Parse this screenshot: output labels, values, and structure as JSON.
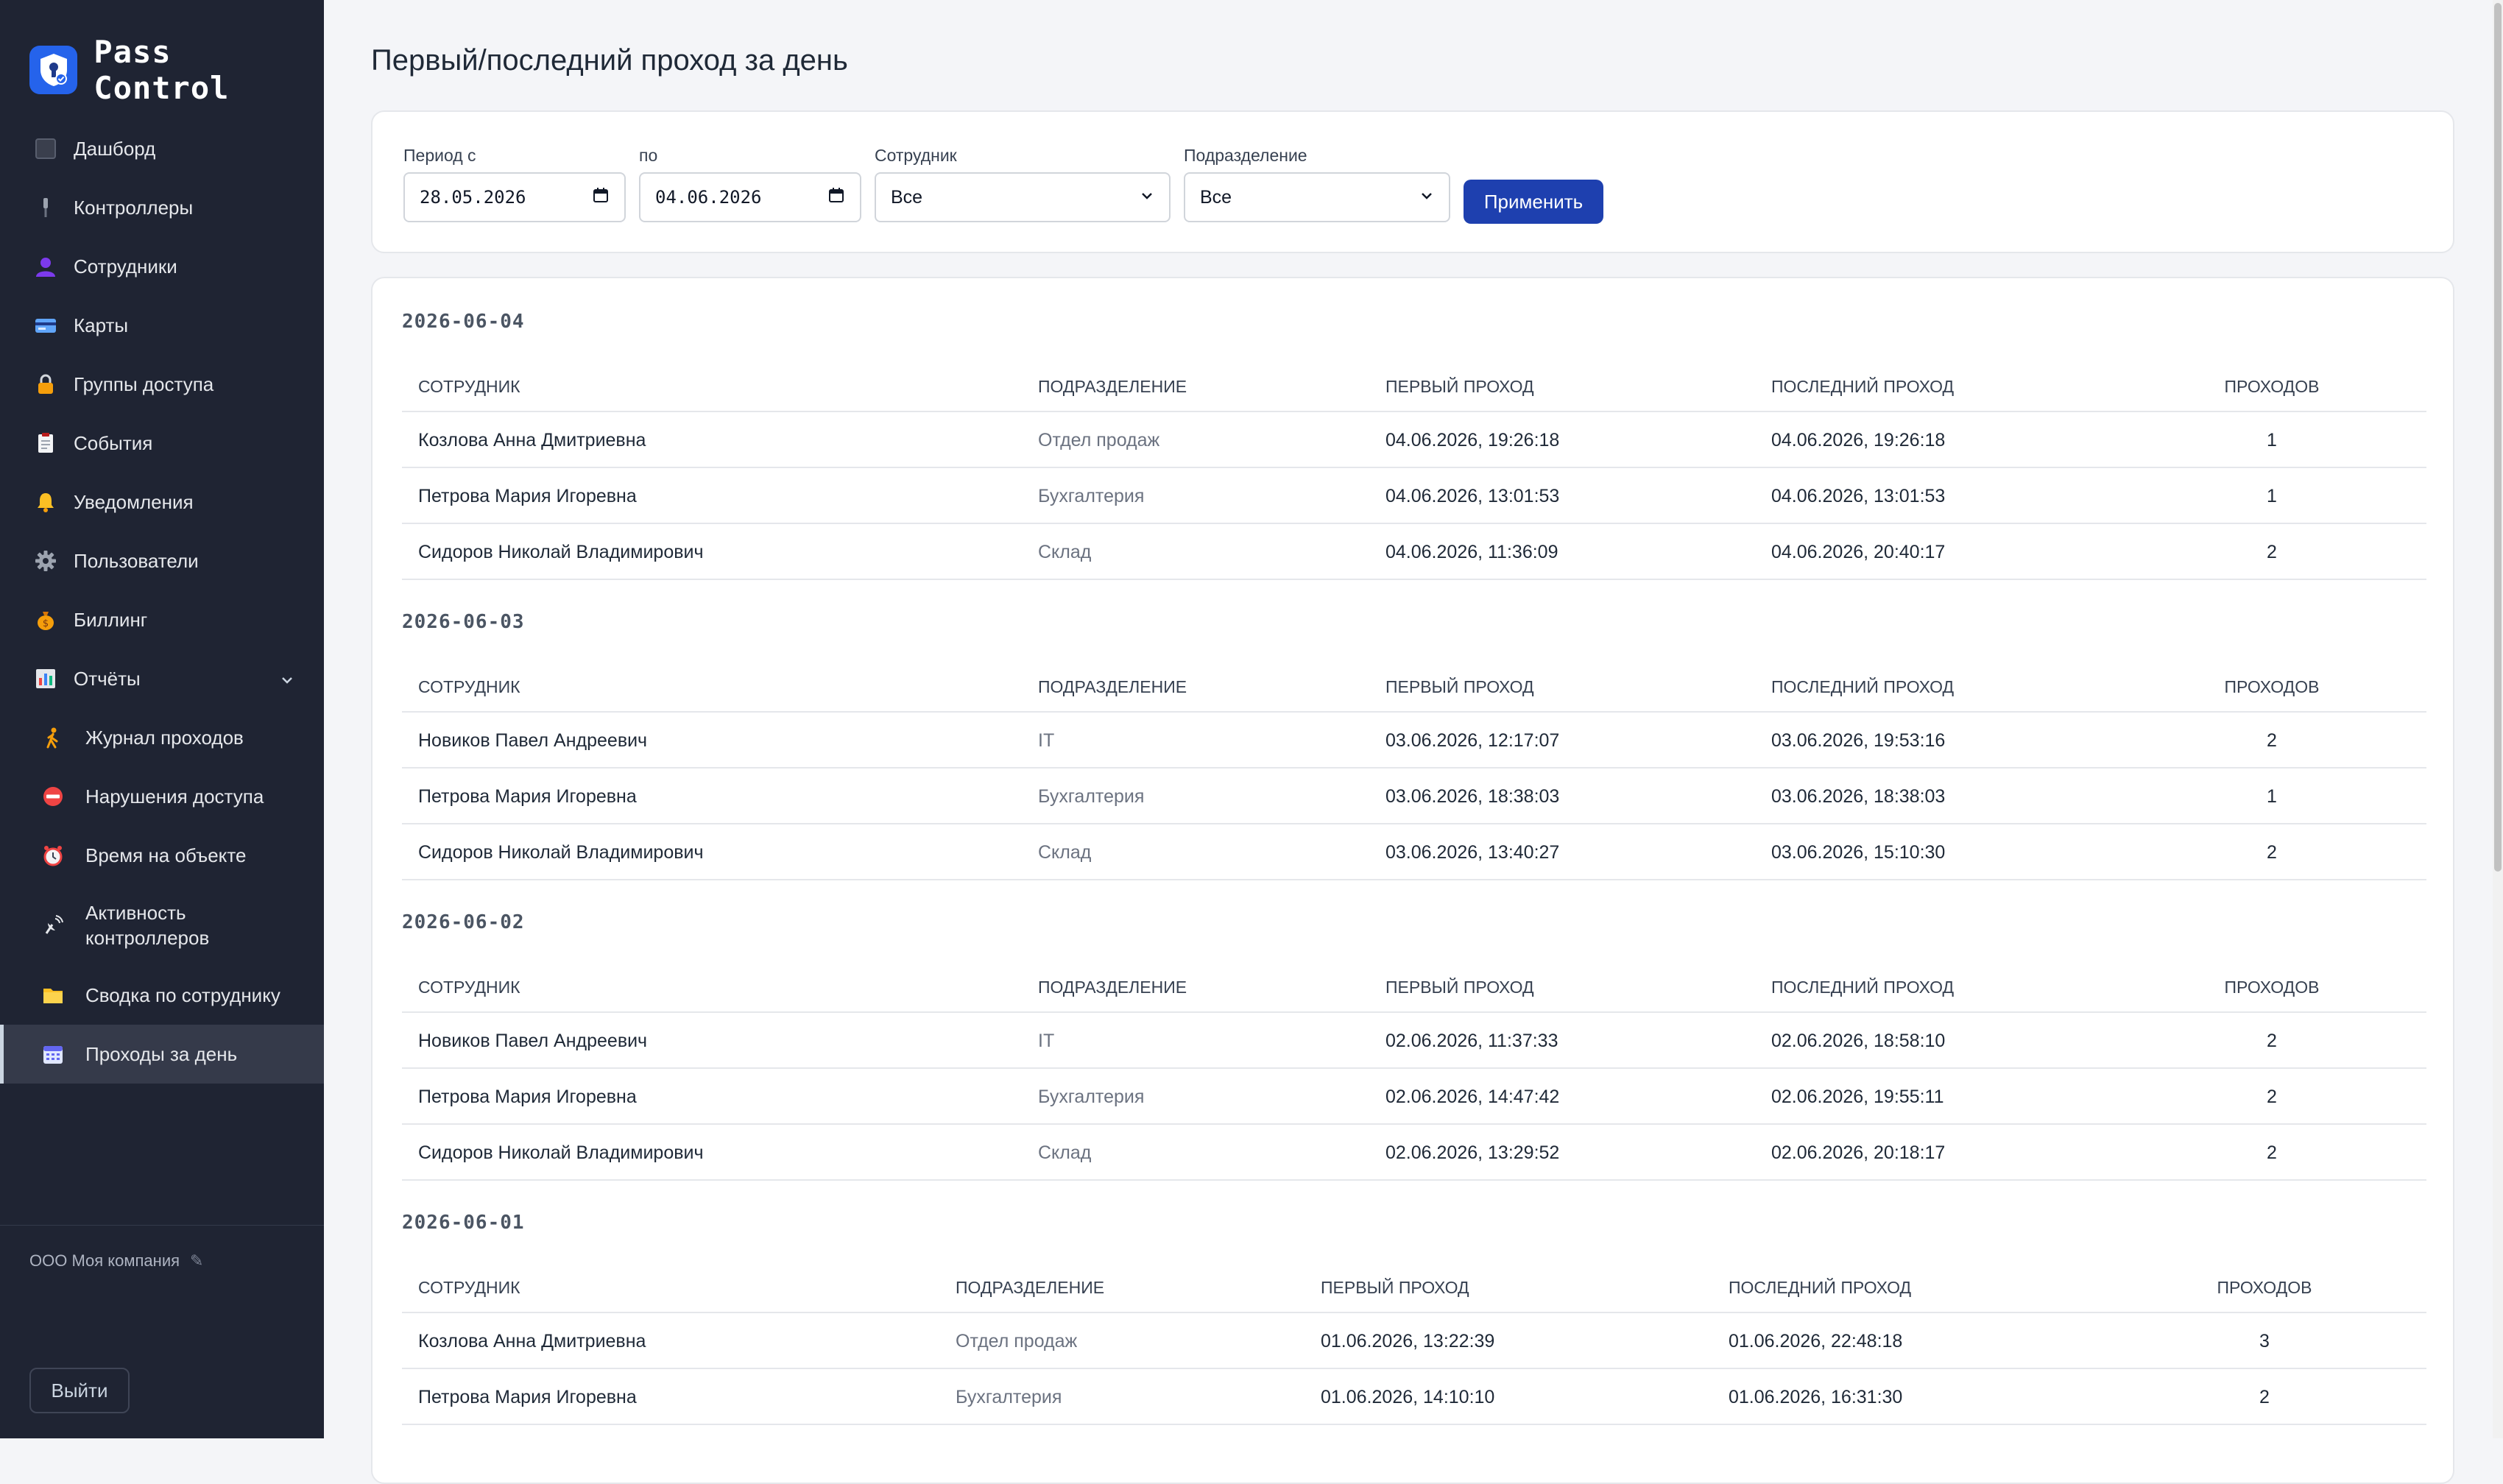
{
  "brand": {
    "name": "Pass Control"
  },
  "sidebar": {
    "items": [
      {
        "label": "Дашборд",
        "icon": "dashboard-icon"
      },
      {
        "label": "Контроллеры",
        "icon": "controller-icon"
      },
      {
        "label": "Сотрудники",
        "icon": "user-icon"
      },
      {
        "label": "Карты",
        "icon": "card-icon"
      },
      {
        "label": "Группы доступа",
        "icon": "lock-icon"
      },
      {
        "label": "События",
        "icon": "clipboard-icon"
      },
      {
        "label": "Уведомления",
        "icon": "bell-icon"
      },
      {
        "label": "Пользователи",
        "icon": "gear-icon"
      },
      {
        "label": "Биллинг",
        "icon": "money-bag-icon"
      },
      {
        "label": "Отчёты",
        "icon": "chart-icon"
      }
    ],
    "report_items": [
      {
        "label": "Журнал проходов",
        "icon": "walking-person-icon"
      },
      {
        "label": "Нарушения доступа",
        "icon": "no-entry-icon"
      },
      {
        "label": "Время на объекте",
        "icon": "alarm-clock-icon"
      },
      {
        "label": "Активность контроллеров",
        "icon": "satellite-icon"
      },
      {
        "label": "Сводка по сотруднику",
        "icon": "folder-icon"
      },
      {
        "label": "Проходы за день",
        "icon": "calendar-icon"
      }
    ],
    "company": "ООО Моя компания",
    "logout_label": "Выйти"
  },
  "page": {
    "title": "Первый/последний проход за день"
  },
  "filters": {
    "period_from_label": "Период с",
    "period_from_value": "28.05.2026",
    "period_to_label": "по",
    "period_to_value": "04.06.2026",
    "employee_label": "Сотрудник",
    "employee_value": "Все",
    "department_label": "Подразделение",
    "department_value": "Все",
    "apply_label": "Применить"
  },
  "table": {
    "columns": [
      "Сотрудник",
      "Подразделение",
      "Первый проход",
      "Последний проход",
      "Проходов"
    ],
    "days": [
      {
        "date": "2026-06-04",
        "rows": [
          {
            "employee": "Козлова Анна Дмитриевна",
            "department": "Отдел продаж",
            "first": "04.06.2026, 19:26:18",
            "last": "04.06.2026, 19:26:18",
            "count": "1"
          },
          {
            "employee": "Петрова Мария Игоревна",
            "department": "Бухгалтерия",
            "first": "04.06.2026, 13:01:53",
            "last": "04.06.2026, 13:01:53",
            "count": "1"
          },
          {
            "employee": "Сидоров Николай Владимирович",
            "department": "Склад",
            "first": "04.06.2026, 11:36:09",
            "last": "04.06.2026, 20:40:17",
            "count": "2"
          }
        ]
      },
      {
        "date": "2026-06-03",
        "rows": [
          {
            "employee": "Новиков Павел Андреевич",
            "department": "IT",
            "first": "03.06.2026, 12:17:07",
            "last": "03.06.2026, 19:53:16",
            "count": "2"
          },
          {
            "employee": "Петрова Мария Игоревна",
            "department": "Бухгалтерия",
            "first": "03.06.2026, 18:38:03",
            "last": "03.06.2026, 18:38:03",
            "count": "1"
          },
          {
            "employee": "Сидоров Николай Владимирович",
            "department": "Склад",
            "first": "03.06.2026, 13:40:27",
            "last": "03.06.2026, 15:10:30",
            "count": "2"
          }
        ]
      },
      {
        "date": "2026-06-02",
        "rows": [
          {
            "employee": "Новиков Павел Андреевич",
            "department": "IT",
            "first": "02.06.2026, 11:37:33",
            "last": "02.06.2026, 18:58:10",
            "count": "2"
          },
          {
            "employee": "Петрова Мария Игоревна",
            "department": "Бухгалтерия",
            "first": "02.06.2026, 14:47:42",
            "last": "02.06.2026, 19:55:11",
            "count": "2"
          },
          {
            "employee": "Сидоров Николай Владимирович",
            "department": "Склад",
            "first": "02.06.2026, 13:29:52",
            "last": "02.06.2026, 20:18:17",
            "count": "2"
          }
        ]
      },
      {
        "date": "2026-06-01",
        "rows": [
          {
            "employee": "Козлова Анна Дмитриевна",
            "department": "Отдел продаж",
            "first": "01.06.2026, 13:22:39",
            "last": "01.06.2026, 22:48:18",
            "count": "3"
          },
          {
            "employee": "Петрова Мария Игоревна",
            "department": "Бухгалтерия",
            "first": "01.06.2026, 14:10:10",
            "last": "01.06.2026, 16:31:30",
            "count": "2"
          }
        ]
      }
    ]
  },
  "colors": {
    "sidebar_bg": "#1f2433",
    "accent": "#1e40af",
    "brand_logo": "#2563eb"
  }
}
